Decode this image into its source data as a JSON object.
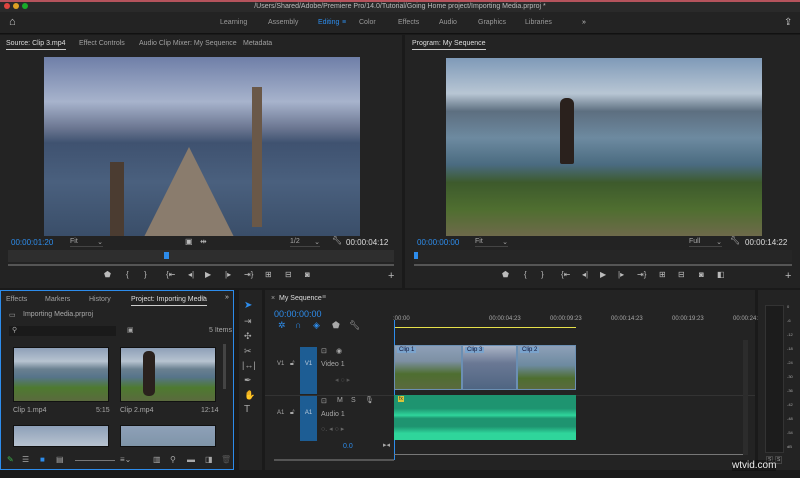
{
  "window": {
    "title": "/Users/Shared/Adobe/Premiere Pro/14.0/Tutorial/Going Home project/Importing Media.prproj *"
  },
  "workspaces": [
    "Learning",
    "Assembly",
    "Editing",
    "Color",
    "Effects",
    "Audio",
    "Graphics",
    "Libraries"
  ],
  "active_workspace": "Editing",
  "source": {
    "tabs": [
      "Source: Clip 3.mp4",
      "Effect Controls",
      "Audio Clip Mixer: My Sequence",
      "Metadata"
    ],
    "timecode": "00:00:01:20",
    "fit": "Fit",
    "resolution": "1/2",
    "duration": "00:00:04:12",
    "playhead_fraction": 0.41
  },
  "program": {
    "tab": "Program: My Sequence",
    "timecode": "00:00:00:00",
    "fit": "Fit",
    "resolution": "Full",
    "duration": "00:00:14:22",
    "playhead_fraction": 0.0
  },
  "project": {
    "tabs": [
      "Effects",
      "Markers",
      "History",
      "Project: Importing Media"
    ],
    "file": "Importing Media.prproj",
    "items_count": "5 Items",
    "clips": [
      {
        "name": "Clip 1.mp4",
        "duration": "5:15"
      },
      {
        "name": "Clip 2.mp4",
        "duration": "12:14"
      }
    ]
  },
  "timeline": {
    "tab": "My Sequence",
    "timecode": "00:00:00:00",
    "ruler": [
      ":00:00",
      "00:00:04:23",
      "00:00:09:23",
      "00:00:14:23",
      "00:00:19:23",
      "00:00:24:23"
    ],
    "tracks": {
      "v1": {
        "label": "V1",
        "name": "Video 1"
      },
      "a1": {
        "label": "A1",
        "name": "Audio 1"
      }
    },
    "clips": [
      "Clip 1",
      "Clip 3",
      "Clip 2"
    ],
    "mix_value": "0.0"
  },
  "meters": {
    "scale": [
      "0",
      "-6",
      "-12",
      "-18",
      "-24",
      "-30",
      "-36",
      "-42",
      "-48",
      "-54",
      "dB"
    ],
    "solo": [
      "S",
      "S"
    ]
  },
  "watermark": "wtvid.com"
}
